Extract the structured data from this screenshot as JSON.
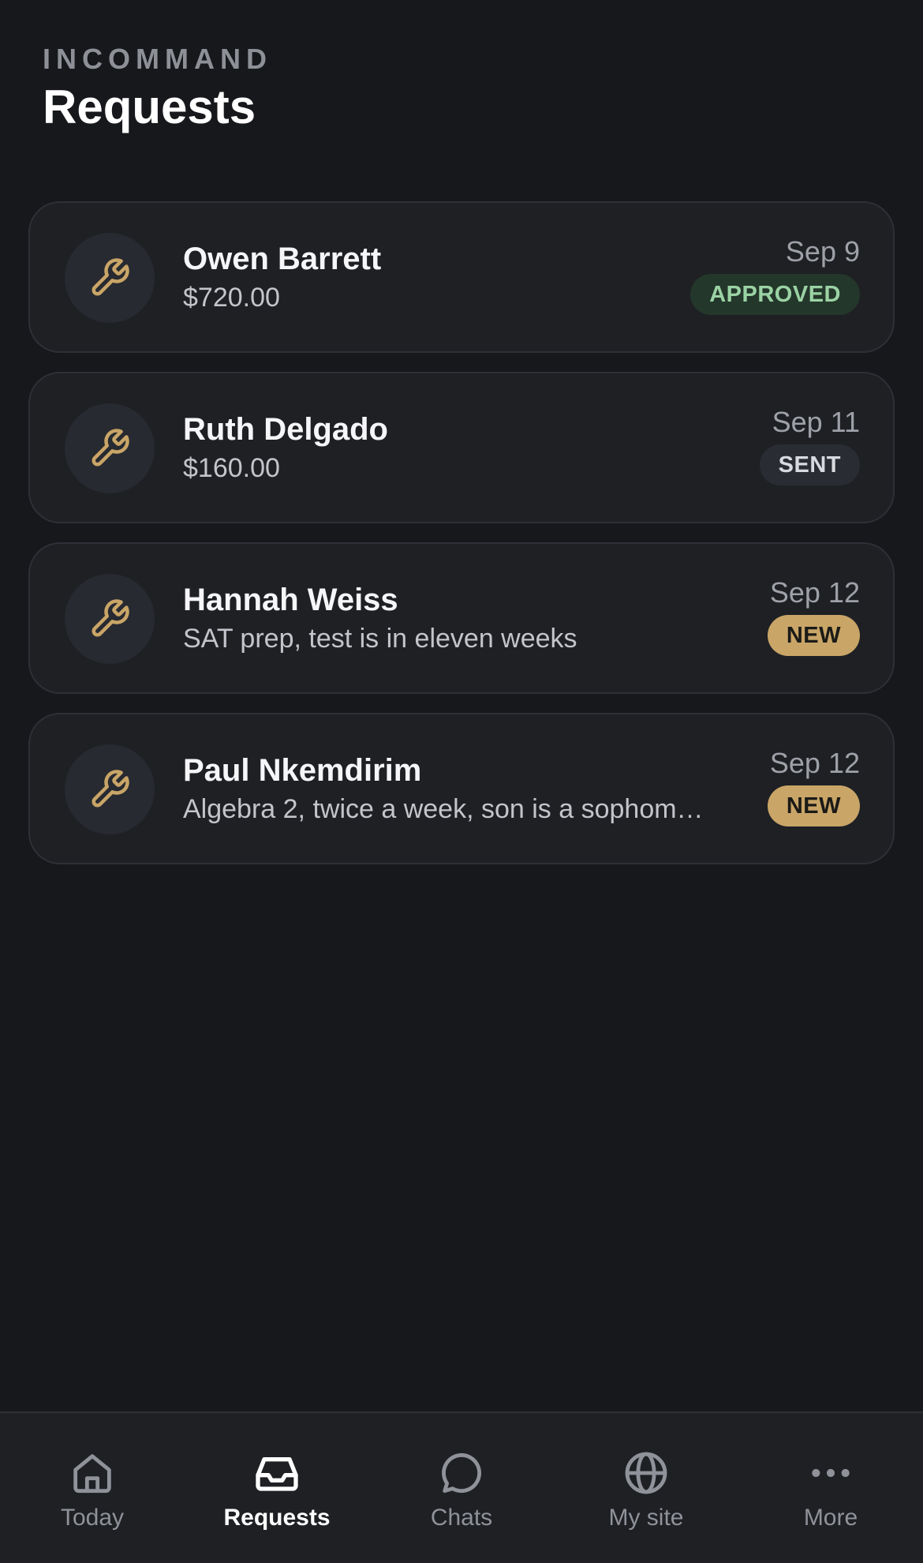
{
  "header": {
    "brand": "INCOMMAND",
    "title": "Requests"
  },
  "requests": [
    {
      "name": "Owen Barrett",
      "detail": "$720.00",
      "date": "Sep 9",
      "status": "APPROVED",
      "status_kind": "approved",
      "icon": "wrench-icon"
    },
    {
      "name": "Ruth Delgado",
      "detail": "$160.00",
      "date": "Sep 11",
      "status": "SENT",
      "status_kind": "sent",
      "icon": "wrench-icon"
    },
    {
      "name": "Hannah Weiss",
      "detail": "SAT prep, test is in eleven weeks",
      "date": "Sep 12",
      "status": "NEW",
      "status_kind": "new",
      "icon": "wrench-icon"
    },
    {
      "name": "Paul Nkemdirim",
      "detail": "Algebra 2, twice a week, son is a sophom…",
      "date": "Sep 12",
      "status": "NEW",
      "status_kind": "new",
      "icon": "wrench-icon"
    }
  ],
  "tabbar": {
    "active": "Requests",
    "tabs": [
      {
        "label": "Today",
        "icon": "home-icon"
      },
      {
        "label": "Requests",
        "icon": "inbox-icon"
      },
      {
        "label": "Chats",
        "icon": "chat-bubble-icon"
      },
      {
        "label": "My site",
        "icon": "globe-icon"
      },
      {
        "label": "More",
        "icon": "more-dots-icon"
      }
    ]
  },
  "colors": {
    "background": "#17181b",
    "card": "#1e2024",
    "accent": "#c9a567",
    "approved_text": "#9bd3a4",
    "approved_bg": "#24372b"
  }
}
